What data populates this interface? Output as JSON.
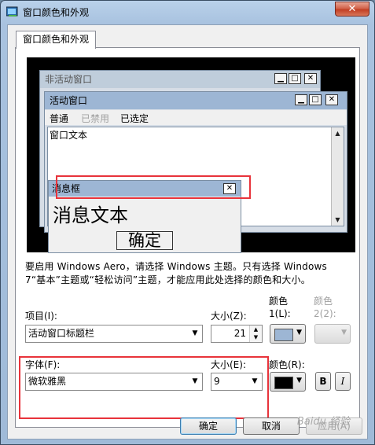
{
  "window": {
    "title": "窗口颜色和外观",
    "close_glyph": "✕"
  },
  "tab": {
    "label": "窗口颜色和外观"
  },
  "preview": {
    "inactive_window": {
      "title": "非活动窗口"
    },
    "active_window": {
      "title": "活动窗口",
      "menu": [
        "普通",
        "已禁用",
        "已选定"
      ],
      "window_text": "窗口文本"
    },
    "message_box": {
      "title": "消息框",
      "text": "消息文本",
      "ok_label": "确定"
    },
    "caption_glyphs": {
      "minimize": "▁",
      "maximize": "□",
      "close": "✕"
    }
  },
  "description": "要启用 Windows Aero，请选择 Windows 主题。只有选择 Windows 7“基本”主题或“轻松访问”主题，才能应用此处选择的颜色和大小。",
  "item_row": {
    "item_label": "项目(I):",
    "item_value": "活动窗口标题栏",
    "size_label": "大小(Z):",
    "size_value": "21",
    "color1_label_line1": "颜色",
    "color1_label_line2": "1(L):",
    "color1_value": "#9db6d4",
    "color2_label_line1": "颜色",
    "color2_label_line2": "2(2):"
  },
  "font_row": {
    "font_label": "字体(F):",
    "font_value": "微软雅黑",
    "size_label": "大小(E):",
    "size_value": "9",
    "color_label": "颜色(R):",
    "color_value": "#000000",
    "bold_label": "B",
    "italic_label": "I"
  },
  "buttons": {
    "ok": "确定",
    "cancel": "取消",
    "apply": "应用(A)"
  },
  "watermark": "Baidu 经验"
}
